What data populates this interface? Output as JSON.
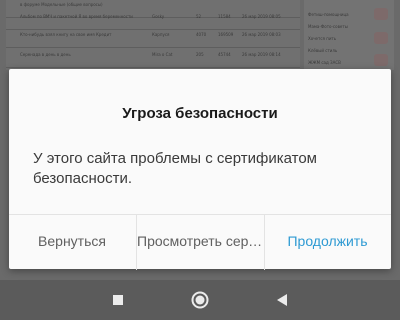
{
  "background_page": {
    "rows": [
      {
        "topic": "в форуме Модельные (общие вопросы)",
        "author": "",
        "replies": "",
        "views": "",
        "last": ""
      },
      {
        "topic": "Альбом по ВМЧ и пакетной Я во время беременности",
        "author": "Gosky",
        "replies": "52",
        "views": "11584",
        "last": "26 мар 2019 08:05"
      },
      {
        "topic": "Кто-нибудь взял книгу на свое имя Кредит",
        "author": "Карпуся",
        "replies": "4070",
        "views": "169509",
        "last": "26 мар 2019 08:03"
      },
      {
        "topic": "Серенада в день в день",
        "author": "Mira o Cat",
        "replies": "205",
        "views": "45744",
        "last": "26 мар 2019 08:14"
      }
    ],
    "side_items": [
      "Фетиш-помощница",
      "Мама-Фото-советы",
      "Хочется пить",
      "Клёвый стиль",
      "ЖЖМ сад ЗАСВ"
    ]
  },
  "dialog": {
    "title": "Угроза безопасности",
    "message": "У этого сайта проблемы с сертификатом безопасности.",
    "buttons": {
      "back": "Вернуться",
      "view": "Просмотреть сертификат",
      "continue": "Продолжить"
    }
  },
  "navbar": {
    "recents_icon": "square-recents-icon",
    "home_icon": "circle-home-icon",
    "back_icon": "triangle-back-icon"
  },
  "colors": {
    "accent": "#2e9ad3",
    "dim_overlay": "#5b5b5b",
    "dialog_bg": "#fafafa"
  }
}
